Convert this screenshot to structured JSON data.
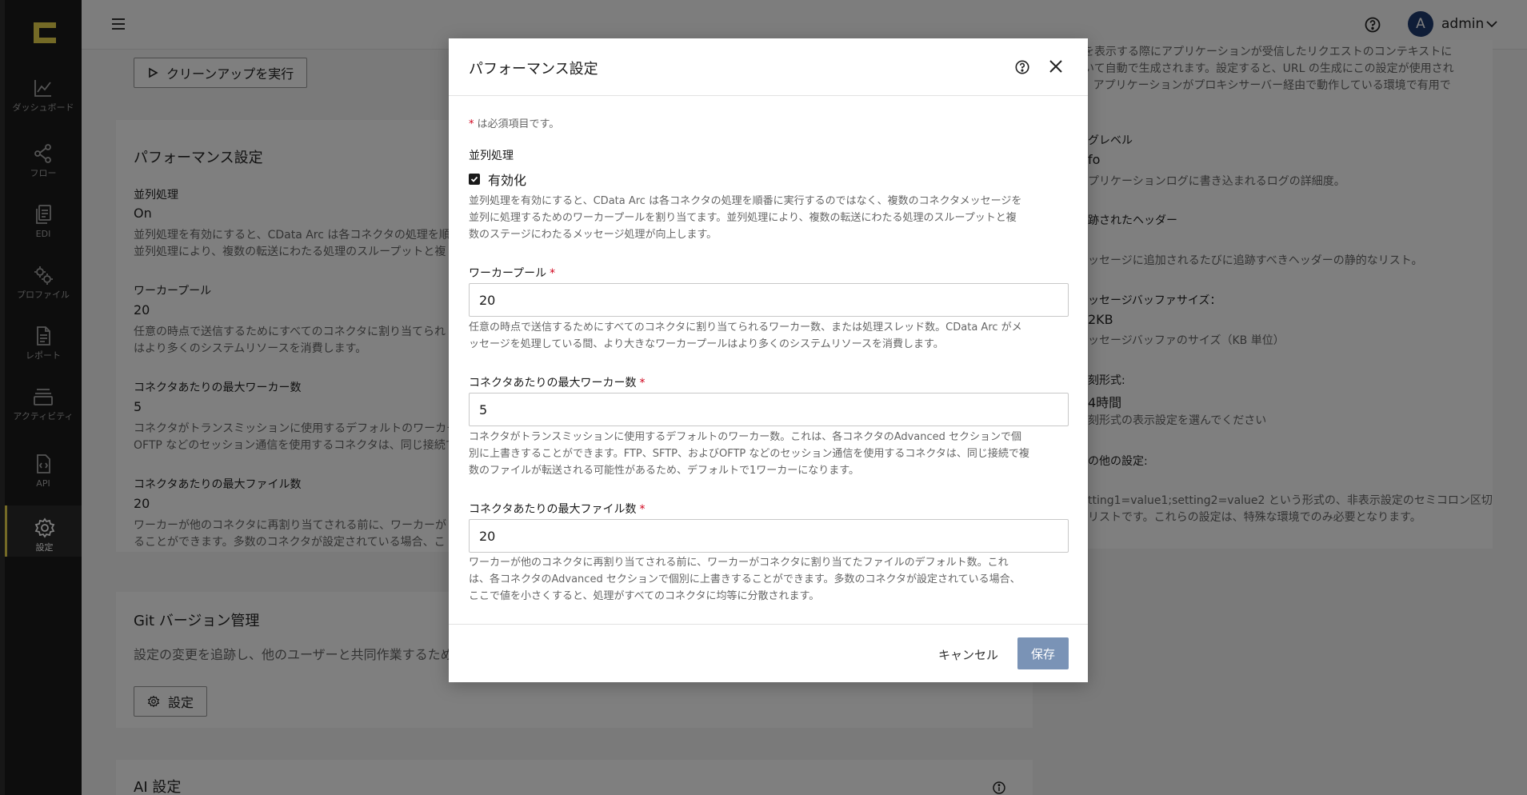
{
  "sidebar": {
    "items": [
      {
        "label": "ダッシュボード",
        "icon": "chart-line-icon"
      },
      {
        "label": "フロー",
        "icon": "flow-icon"
      },
      {
        "label": "EDI",
        "icon": "document-copy-icon"
      },
      {
        "label": "プロファイル",
        "icon": "gears-icon"
      },
      {
        "label": "レポート",
        "icon": "report-icon"
      },
      {
        "label": "アクティビティ",
        "icon": "activity-icon"
      },
      {
        "label": "API",
        "icon": "api-icon"
      },
      {
        "label": "設定",
        "icon": "settings-icon"
      }
    ],
    "active_color": "#e8d44d"
  },
  "topbar": {
    "avatar_letter": "A",
    "username": "admin"
  },
  "background": {
    "cleanup_button": "クリーンアップを実行",
    "perf_card": {
      "title": "パフォーマンス設定",
      "parallel_label": "並列処理",
      "parallel_value": "On",
      "parallel_desc_1": "並列処理を有効にすると、CData Arc は各コネクタの処理を順",
      "parallel_desc_2": "並列処理により、複数の転送にわたる処理のスループットと複",
      "worker_label": "ワーカープール",
      "worker_value": "20",
      "worker_desc_1": "任意の時点で送信するためにすべてのコネクタに割り当てられ",
      "worker_desc_2": "はより多くのシステムリソースを消費します。",
      "max_worker_label": "コネクタあたりの最大ワーカー数",
      "max_worker_value": "5",
      "max_worker_desc_1": "コネクタがトランスミッションに使用するデフォルトのワーカー",
      "max_worker_desc_2": "OFTP などのセッション通信を使用するコネクタは、同じ接続で",
      "max_file_label": "コネクタあたりの最大ファイル数",
      "max_file_value": "20",
      "max_file_desc_1": "ワーカーが他のコネクタに再割り当てされる前に、ワーカーが",
      "max_file_desc_2": "ることができます。多数のコネクタが設定されている場合、こ"
    },
    "git_card": {
      "title": "Git バージョン管理",
      "desc": "設定の変更を追跡し、他のユーザーと共同作業するため",
      "button": "設定"
    },
    "ai_card": {
      "title": "AI 設定"
    },
    "right_card": {
      "line1": "ンを表示する際にアプリケーションが受信したリクエストのコンテキストに",
      "line2": "づいて自動で生成されます。設定すると、URL の生成にこの設定が使用され",
      "line3": "す。アプリケーションがプロキシサーバー経由で動作している環境で有用で",
      "log_label": "グレベル",
      "log_value": "fo",
      "log_desc": "プリケーションログに書き込まれるログの詳細度。",
      "header_label": "跡されたヘッダー",
      "header_desc": "ッセージに追加されるたびに追跡すべきヘッダーの静的なリスト。",
      "buffer_label": "ッセージバッファサイズ：",
      "buffer_value": "2KB",
      "buffer_desc": "ッセージバッファのサイズ（KB 単位）",
      "time_label": "刻形式:",
      "time_value": "4時間",
      "time_desc": "刻形式の表示設定を選んでください",
      "other_label": "の他の設定:",
      "other_desc_1": "tting1=value1;setting2=value2 という形式の、非表示設定のセミコロン区切",
      "other_desc_2": "リストです。これらの設定は、特殊な環境でのみ必要となります。"
    }
  },
  "modal": {
    "title": "パフォーマンス設定",
    "required_note": "は必須項目です。",
    "required_star": "*",
    "parallel": {
      "label": "並列処理",
      "checkbox_label": "有効化",
      "checked": true,
      "desc_1": "並列処理を有効にすると、CData Arc は各コネクタの処理を順番に実行するのではなく、複数のコネクタメッセージを",
      "desc_2": "並列に処理するためのワーカープールを割り当てます。並列処理により、複数の転送にわたる処理のスループットと複",
      "desc_3": "数のステージにわたるメッセージ処理が向上します。"
    },
    "worker_pool": {
      "label": "ワーカープール",
      "value": "20",
      "desc_1": "任意の時点で送信するためにすべてのコネクタに割り当てられるワーカー数、または処理スレッド数。CData Arc がメ",
      "desc_2": "ッセージを処理している間、より大きなワーカープールはより多くのシステムリソースを消費します。"
    },
    "max_workers": {
      "label": "コネクタあたりの最大ワーカー数",
      "value": "5",
      "desc_1": "コネクタがトランスミッションに使用するデフォルトのワーカー数。これは、各コネクタのAdvanced セクションで個",
      "desc_2": "別に上書きすることができます。FTP、SFTP、およびOFTP などのセッション通信を使用するコネクタは、同じ接続で複",
      "desc_3": "数のファイルが転送される可能性があるため、デフォルトで1ワーカーになります。"
    },
    "max_files": {
      "label": "コネクタあたりの最大ファイル数",
      "value": "20",
      "desc_1": "ワーカーが他のコネクタに再割り当てされる前に、ワーカーがコネクタに割り当てたファイルのデフォルト数。これ",
      "desc_2": "は、各コネクタのAdvanced セクションで個別に上書きすることができます。多数のコネクタが設定されている場合、",
      "desc_3": "ここで値を小さくすると、処理がすべてのコネクタに均等に分散されます。"
    },
    "cancel_label": "キャンセル",
    "save_label": "保存",
    "save_color": "#7a93b6"
  }
}
